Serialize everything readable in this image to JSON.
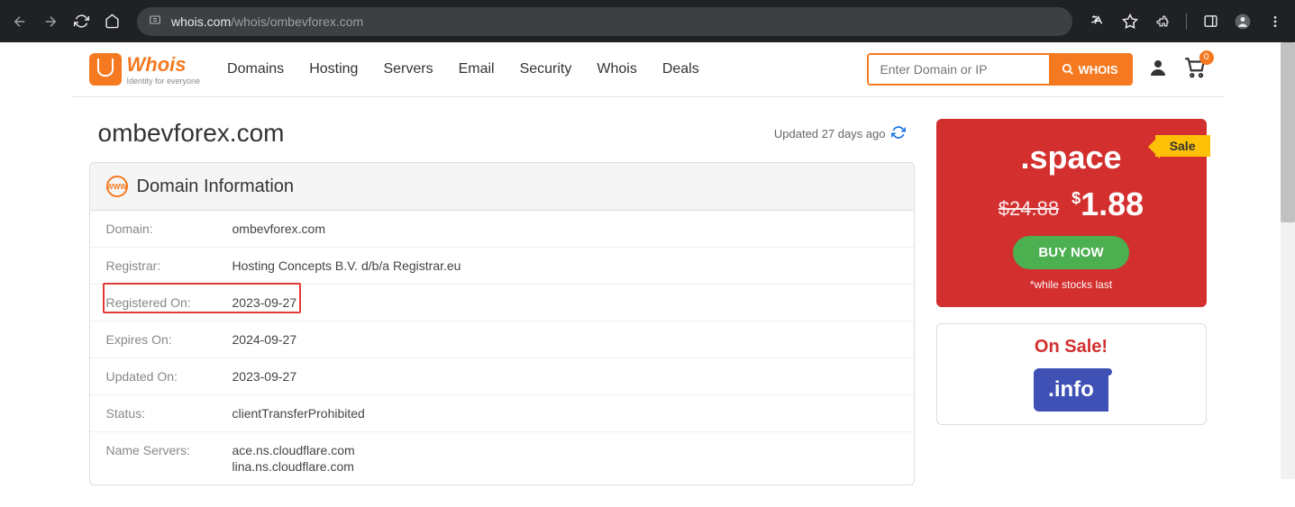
{
  "browser": {
    "url_host": "whois.com",
    "url_path": "/whois/ombevforex.com"
  },
  "logo": {
    "text": "Whois",
    "tagline": "Identity for everyone"
  },
  "nav": [
    "Domains",
    "Hosting",
    "Servers",
    "Email",
    "Security",
    "Whois",
    "Deals"
  ],
  "search": {
    "placeholder": "Enter Domain or IP",
    "button": "WHOIS"
  },
  "cart_count": "0",
  "page": {
    "domain_title": "ombevforex.com",
    "updated_text": "Updated 27 days ago"
  },
  "domain_info": {
    "section_title": "Domain Information",
    "rows": [
      {
        "label": "Domain:",
        "value": "ombevforex.com"
      },
      {
        "label": "Registrar:",
        "value": "Hosting Concepts B.V. d/b/a Registrar.eu"
      },
      {
        "label": "Registered On:",
        "value": "2023-09-27",
        "highlight": true
      },
      {
        "label": "Expires On:",
        "value": "2024-09-27"
      },
      {
        "label": "Updated On:",
        "value": "2023-09-27"
      },
      {
        "label": "Status:",
        "value": "clientTransferProhibited"
      },
      {
        "label": "Name Servers:",
        "value": [
          "ace.ns.cloudflare.com",
          "lina.ns.cloudflare.com"
        ]
      }
    ]
  },
  "promo": {
    "sale_label": "Sale",
    "tld": ".space",
    "old_price": "$24.88",
    "new_price_currency": "$",
    "new_price": "1.88",
    "buy_label": "BUY NOW",
    "note": "*while stocks last"
  },
  "onsale": {
    "title": "On Sale!",
    "tld": ".info"
  }
}
